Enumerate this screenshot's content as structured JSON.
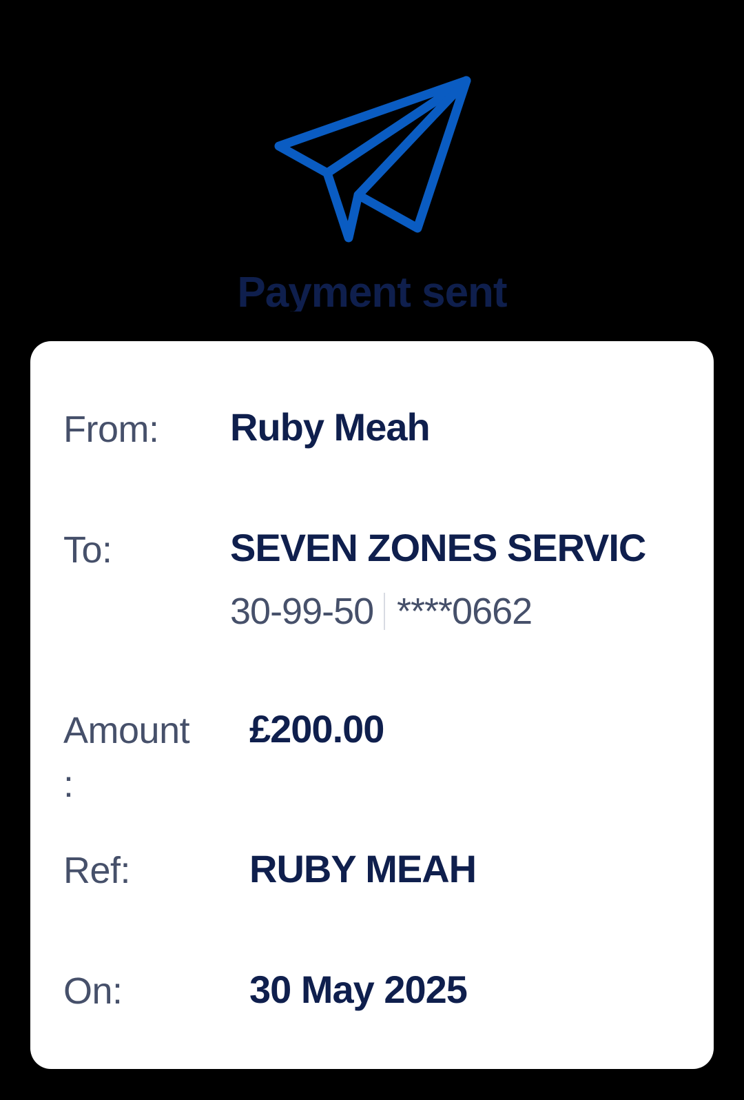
{
  "header": {
    "icon": "paper-plane-icon",
    "title": "Payment sent",
    "accent_color": "#0a5cc2",
    "title_color": "#0f1f4d"
  },
  "details": {
    "from": {
      "label": "From:",
      "value": "Ruby Meah"
    },
    "to": {
      "label": "To:",
      "value": "SEVEN ZONES SERVIC",
      "sort_code": "30-99-50",
      "account": "****0662"
    },
    "amount": {
      "label": "Amount",
      "label_colon": ":",
      "value": "£200.00"
    },
    "ref": {
      "label": "Ref:",
      "value": "RUBY MEAH"
    },
    "on": {
      "label": "On:",
      "value": "30 May 2025"
    }
  },
  "colors": {
    "value_text": "#0f1f4d",
    "label_text": "#46506a",
    "card_bg": "#ffffff",
    "page_bg": "#000000"
  }
}
